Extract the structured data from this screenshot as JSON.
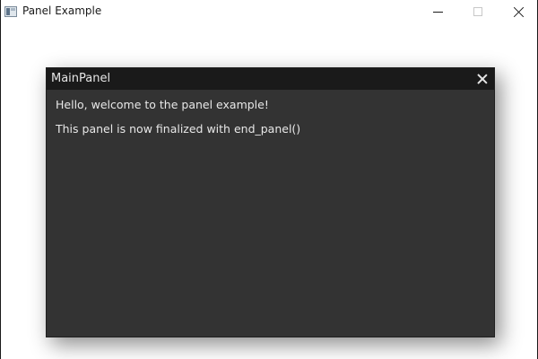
{
  "window": {
    "title": "Panel Example",
    "icon": "application-icon",
    "controls": {
      "minimize": "minimize-icon",
      "maximize": "maximize-icon",
      "close": "close-icon"
    }
  },
  "panel": {
    "title": "MainPanel",
    "close_icon": "close-icon",
    "lines": [
      "Hello, welcome to the panel example!",
      "This panel is now finalized with end_panel()"
    ]
  },
  "colors": {
    "panel_background": "#333333",
    "panel_header": "#1a1a1a",
    "panel_text": "#e8e8e8",
    "window_background": "#ffffff"
  }
}
